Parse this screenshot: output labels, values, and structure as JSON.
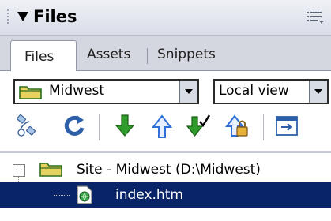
{
  "panel": {
    "title": "Files",
    "tabs": [
      {
        "label": "Files",
        "active": true
      },
      {
        "label": "Assets",
        "active": false
      },
      {
        "label": "Snippets",
        "active": false
      }
    ]
  },
  "site_select": {
    "value": "Midwest"
  },
  "view_select": {
    "value": "Local view"
  },
  "toolbar": {
    "buttons": [
      {
        "icon": "connect-icon"
      },
      {
        "icon": "refresh-icon"
      },
      {
        "icon": "get-files-icon"
      },
      {
        "icon": "put-files-icon"
      },
      {
        "icon": "check-out-icon"
      },
      {
        "icon": "check-in-icon"
      },
      {
        "icon": "expand-panel-icon"
      }
    ]
  },
  "tree": {
    "items": [
      {
        "label": "Site - Midwest (D:\\Midwest)",
        "expanded": true,
        "selected": false
      },
      {
        "label": "index.htm",
        "selected": true
      }
    ]
  },
  "colors": {
    "selection": "#0a246a",
    "folder": "#e6d35f",
    "arrow_green": "#2e9b2a",
    "arrow_blue": "#2d6fd6"
  }
}
